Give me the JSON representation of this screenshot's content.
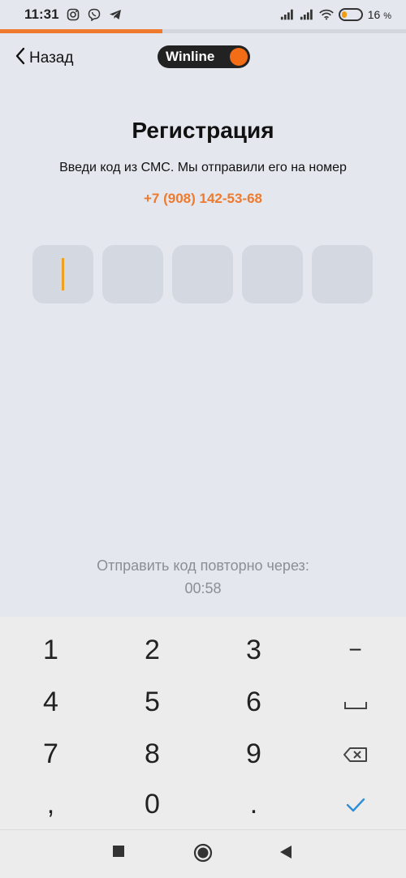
{
  "status_bar": {
    "time": "11:31",
    "battery": "16",
    "battery_unit": "%"
  },
  "progress": {
    "fraction": 0.4,
    "color": "#ef7a2e"
  },
  "header": {
    "back_label": "Назад",
    "logo_text": "Winline"
  },
  "main": {
    "title": "Регистрация",
    "subtitle": "Введи код из СМС. Мы отправили его на номер",
    "phone": "+7 (908) 142-53-68",
    "code_boxes": [
      "",
      "",
      "",
      "",
      ""
    ],
    "resend_text": "Отправить код повторно через:",
    "resend_timer": "00:58"
  },
  "keyboard": {
    "keys": [
      "1",
      "2",
      "3",
      "−",
      "4",
      "5",
      "6",
      "space",
      "7",
      "8",
      "9",
      "backspace",
      ",",
      "0",
      ".",
      "done"
    ]
  },
  "colors": {
    "accent": "#ef7a2e",
    "check": "#2f8fd6"
  }
}
